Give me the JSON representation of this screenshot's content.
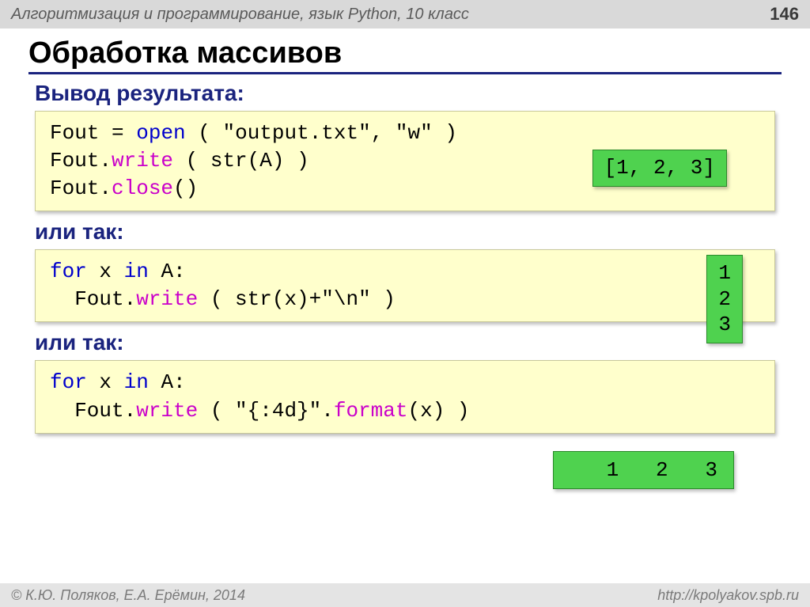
{
  "header": {
    "course": "Алгоритмизация и программирование, язык Python, 10 класс",
    "page": "146"
  },
  "title": "Обработка массивов",
  "sections": {
    "s1": {
      "heading": "Вывод результата:",
      "code": {
        "l1a": "Fout",
        "l1b": "=",
        "l1c": "open",
        "l1d": "( \"output.txt\", \"w\" )",
        "l2a": "Fout.",
        "l2b": "write",
        "l2c": "( str(A) )",
        "l3a": "Fout.",
        "l3b": "close",
        "l3c": "()"
      },
      "output": "[1, 2, 3]"
    },
    "s2": {
      "heading": "или так:",
      "code": {
        "l1a": "for",
        "l1b": " x ",
        "l1c": "in",
        "l1d": " A:",
        "l2a": "  Fout.",
        "l2b": "write",
        "l2c": "( str(x)+\"\\n\" )"
      },
      "output": "1\n2\n3"
    },
    "s3": {
      "heading": "или так:",
      "code": {
        "l1a": "for",
        "l1b": " x ",
        "l1c": "in",
        "l1d": " A:",
        "l2a": "  Fout.",
        "l2b": "write",
        "l2c": "( \"{:4d}\".",
        "l2d": "format",
        "l2e": "(x) )"
      },
      "output": "   1   2   3"
    }
  },
  "footer": {
    "copyright": "© К.Ю. Поляков, Е.А. Ерёмин, 2014",
    "url": "http://kpolyakov.spb.ru"
  }
}
